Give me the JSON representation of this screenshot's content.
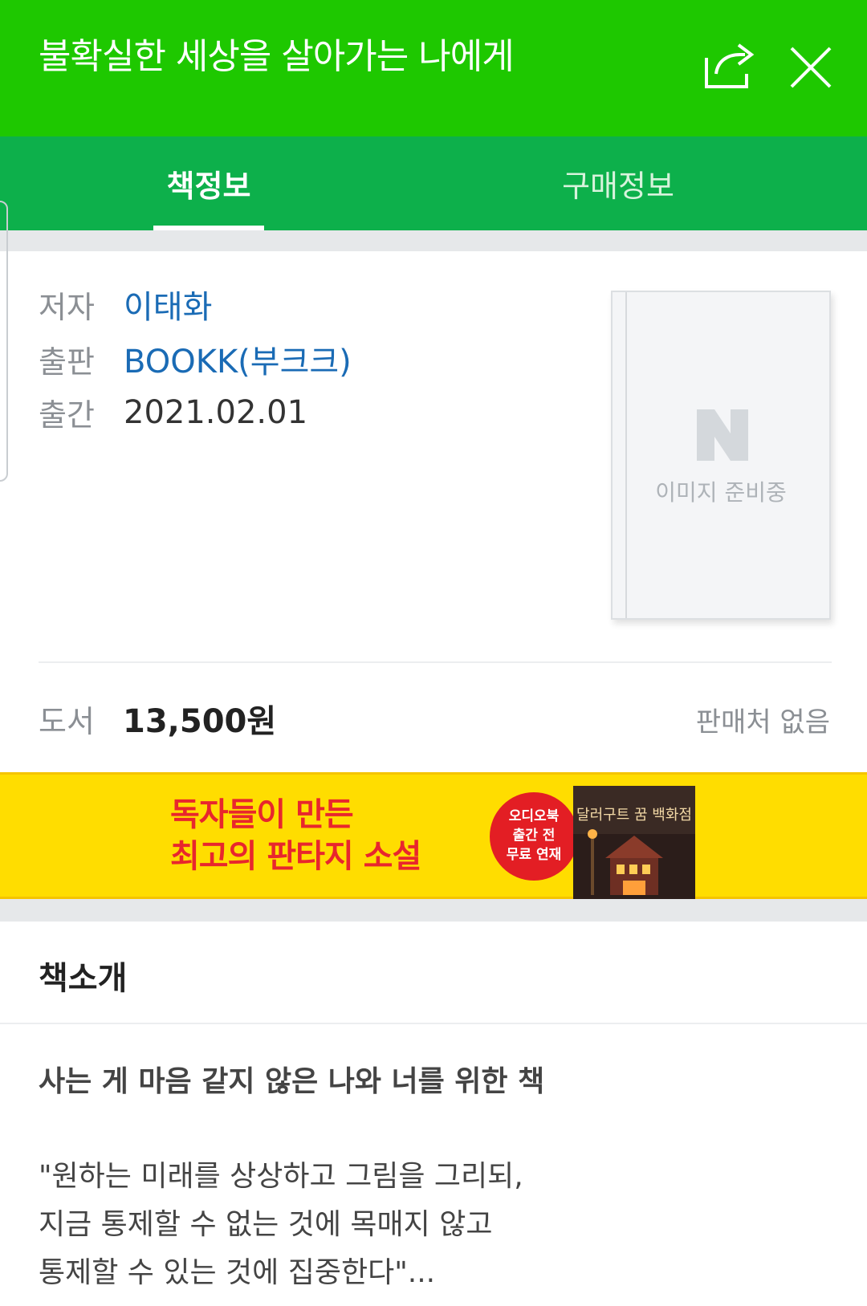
{
  "header": {
    "title": "불확실한 세상을 살아가는 나에게",
    "share_icon": "share-icon",
    "close_icon": "close-icon"
  },
  "tabs": [
    {
      "label": "책정보",
      "active": true
    },
    {
      "label": "구매정보",
      "active": false
    }
  ],
  "book_info": {
    "author_label": "저자",
    "author": "이태화",
    "publisher_label": "출판",
    "publisher": "BOOKK(부크크)",
    "date_label": "출간",
    "date": "2021.02.01"
  },
  "cover": {
    "placeholder_text": "이미지 준비중",
    "logo_letter": "N"
  },
  "price": {
    "label": "도서",
    "value": "13,500원",
    "seller": "판매처 없음"
  },
  "banner": {
    "line1": "독자들이 만든",
    "line2": "최고의 판타지 소설",
    "badge_line1": "오디오북",
    "badge_line2": "출간 전",
    "badge_line3": "무료 연재",
    "book_title": "달러구트 꿈 백화점"
  },
  "intro": {
    "section_title": "책소개",
    "heading": "사는 게 마음 같지 않은 나와 너를 위한 책",
    "lines": [
      "\"원하는 미래를 상상하고 그림을 그리되,",
      "지금 통제할 수 없는 것에 목매지 않고",
      "통제할 수 있는 것에 집중한다\"..."
    ]
  },
  "colors": {
    "header_green": "#1ec800",
    "tab_green": "#0db04b",
    "link_blue": "#1a6bb5",
    "banner_yellow": "#ffdd00",
    "banner_red": "#e8262d"
  }
}
